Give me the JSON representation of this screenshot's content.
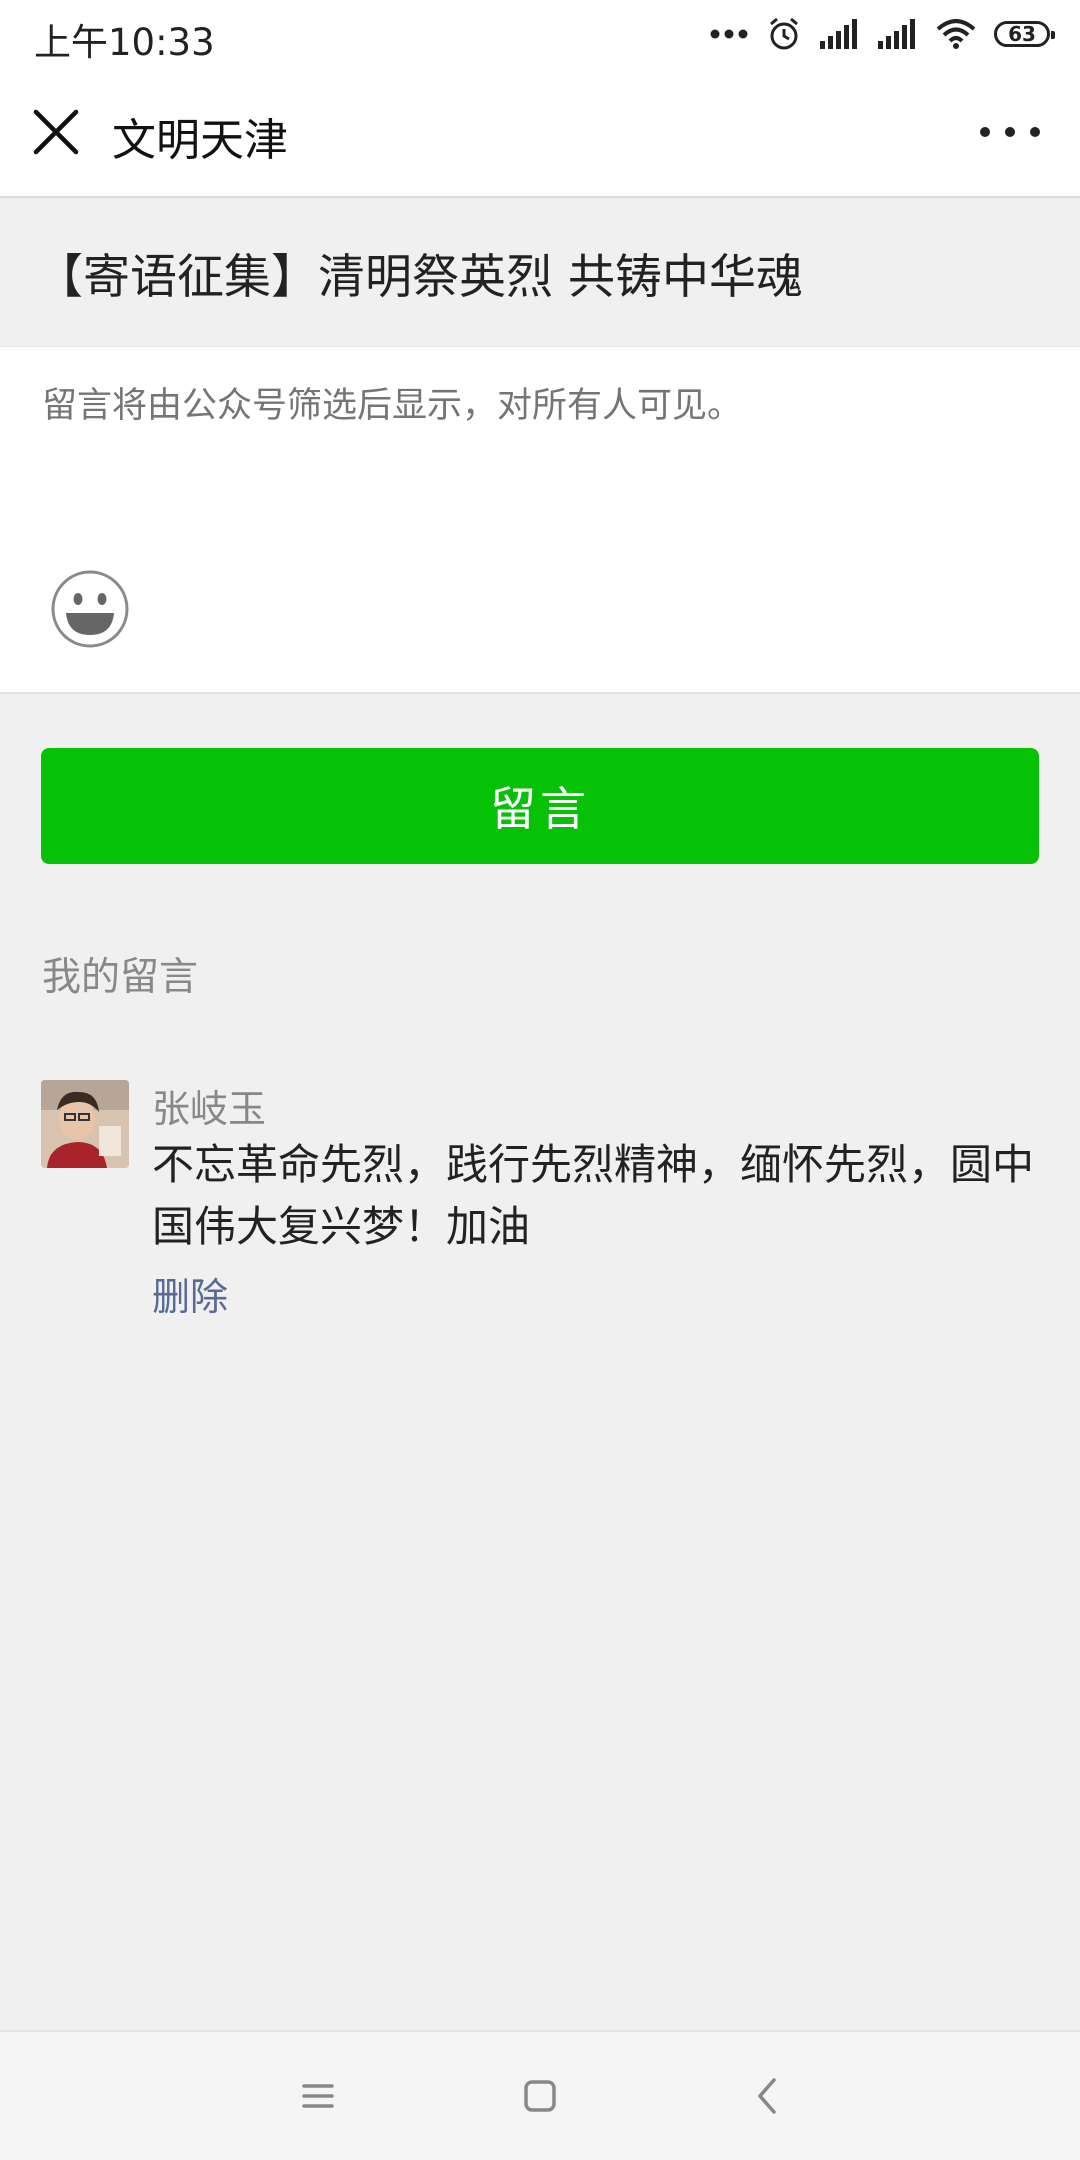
{
  "status_bar": {
    "time": "上午10:33",
    "battery": "63",
    "icons": [
      "more-dots-icon",
      "alarm-icon",
      "signal-icon",
      "signal-icon",
      "wifi-icon",
      "battery-icon"
    ]
  },
  "nav": {
    "title": "文明天津",
    "close_icon": "close-icon",
    "more_icon": "more-icon"
  },
  "article": {
    "title": "【寄语征集】清明祭英烈 共铸中华魂"
  },
  "comment_input": {
    "placeholder": "留言将由公众号筛选后显示，对所有人可见。",
    "emoji_icon": "emoji-icon"
  },
  "submit": {
    "label": "留言",
    "color": "#07c107"
  },
  "my_comments": {
    "section_label": "我的留言",
    "items": [
      {
        "name": "张岐玉",
        "text": "不忘革命先烈，践行先烈精神，缅怀先烈，圆中国伟大复兴梦！加油",
        "delete_label": "删除"
      }
    ]
  },
  "system_nav": {
    "icons": [
      "menu-icon",
      "home-icon",
      "back-icon"
    ]
  }
}
